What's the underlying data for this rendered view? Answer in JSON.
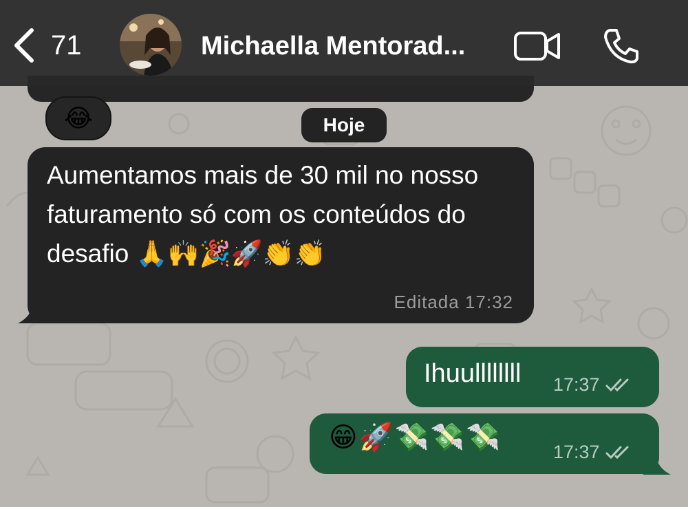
{
  "header": {
    "back_count": "71",
    "contact_name": "Michaella Mentorad..."
  },
  "reaction": {
    "emoji": "😂"
  },
  "day_separator": "Hoje",
  "messages": [
    {
      "direction": "incoming",
      "text": "Aumentamos mais de 30 mil no nosso faturamento só com os conteúdos do desafio 🙏🙌🎉🚀👏👏",
      "meta": "Editada 17:32"
    },
    {
      "direction": "outgoing",
      "text": "Ihuullllllll",
      "time": "17:37",
      "status_icon": "double-check-read"
    },
    {
      "direction": "outgoing",
      "text": "😁🚀💸💸💸",
      "time": "17:37",
      "status_icon": "double-check-read"
    }
  ],
  "colors": {
    "header_bg": "#282828",
    "incoming_bubble": "#232323",
    "outgoing_bubble": "#1d5b3c",
    "wallpaper": "#b9b6b1"
  }
}
